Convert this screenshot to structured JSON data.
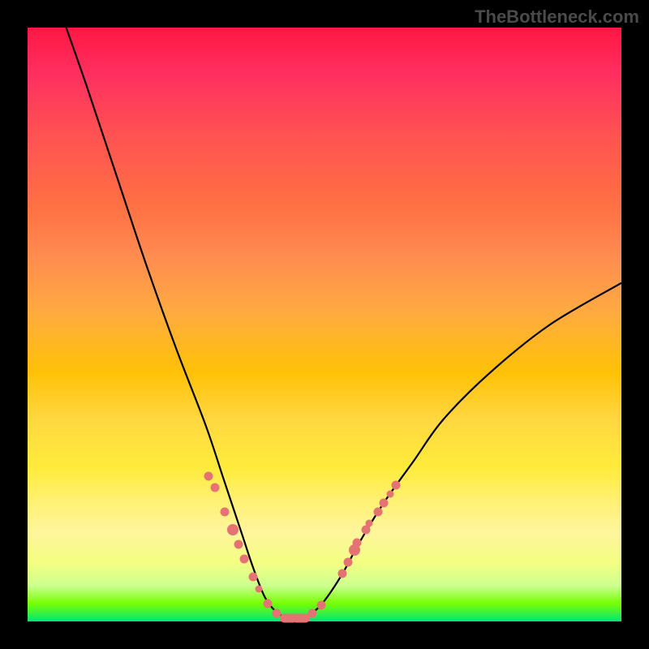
{
  "watermark": "TheBottleneck.com",
  "chart_data": {
    "type": "line",
    "title": "",
    "xlabel": "",
    "ylabel": "",
    "x_range": [
      0,
      100
    ],
    "y_range": [
      0,
      100
    ],
    "curve": {
      "description": "V-shaped bottleneck curve; minimum near x≈44",
      "points": [
        {
          "x": 6.5,
          "y": 100
        },
        {
          "x": 10,
          "y": 90
        },
        {
          "x": 15,
          "y": 75
        },
        {
          "x": 20,
          "y": 60
        },
        {
          "x": 25,
          "y": 46
        },
        {
          "x": 30,
          "y": 33
        },
        {
          "x": 33,
          "y": 24
        },
        {
          "x": 36,
          "y": 15
        },
        {
          "x": 38,
          "y": 9
        },
        {
          "x": 40,
          "y": 4
        },
        {
          "x": 42,
          "y": 1.5
        },
        {
          "x": 44,
          "y": 0.5
        },
        {
          "x": 46,
          "y": 0.5
        },
        {
          "x": 48,
          "y": 1.5
        },
        {
          "x": 50,
          "y": 3.5
        },
        {
          "x": 53,
          "y": 8
        },
        {
          "x": 56,
          "y": 13.5
        },
        {
          "x": 60,
          "y": 20
        },
        {
          "x": 65,
          "y": 27
        },
        {
          "x": 70,
          "y": 34
        },
        {
          "x": 78,
          "y": 42
        },
        {
          "x": 88,
          "y": 50
        },
        {
          "x": 100,
          "y": 57
        }
      ]
    },
    "scatter_points": [
      {
        "x": 30.5,
        "y": 24.5,
        "size": "normal"
      },
      {
        "x": 31.5,
        "y": 22.5,
        "size": "normal"
      },
      {
        "x": 33.2,
        "y": 18.5,
        "size": "normal"
      },
      {
        "x": 34.5,
        "y": 15.5,
        "size": "big"
      },
      {
        "x": 35.5,
        "y": 13.0,
        "size": "normal"
      },
      {
        "x": 36.5,
        "y": 10.5,
        "size": "normal"
      },
      {
        "x": 38.0,
        "y": 7.5,
        "size": "normal"
      },
      {
        "x": 39.0,
        "y": 5.5,
        "size": "small"
      },
      {
        "x": 40.5,
        "y": 3.0,
        "size": "normal"
      },
      {
        "x": 42.0,
        "y": 1.3,
        "size": "normal"
      },
      {
        "x": 44.0,
        "y": 0.6,
        "size": "wide"
      },
      {
        "x": 46.0,
        "y": 0.6,
        "size": "wide"
      },
      {
        "x": 48.0,
        "y": 1.3,
        "size": "normal"
      },
      {
        "x": 49.5,
        "y": 2.8,
        "size": "normal"
      },
      {
        "x": 53.0,
        "y": 8.0,
        "size": "normal"
      },
      {
        "x": 54.0,
        "y": 10.0,
        "size": "normal"
      },
      {
        "x": 55.0,
        "y": 12.0,
        "size": "big"
      },
      {
        "x": 55.5,
        "y": 13.2,
        "size": "normal"
      },
      {
        "x": 57.0,
        "y": 15.5,
        "size": "normal"
      },
      {
        "x": 57.5,
        "y": 16.5,
        "size": "small"
      },
      {
        "x": 59.0,
        "y": 18.5,
        "size": "normal"
      },
      {
        "x": 60.0,
        "y": 20.0,
        "size": "normal"
      },
      {
        "x": 61.0,
        "y": 21.5,
        "size": "small"
      },
      {
        "x": 62.0,
        "y": 23.0,
        "size": "normal"
      }
    ],
    "background_gradient": {
      "top": "#ff1744",
      "middle": "#ffeb3b",
      "bottom": "#00e676"
    }
  }
}
